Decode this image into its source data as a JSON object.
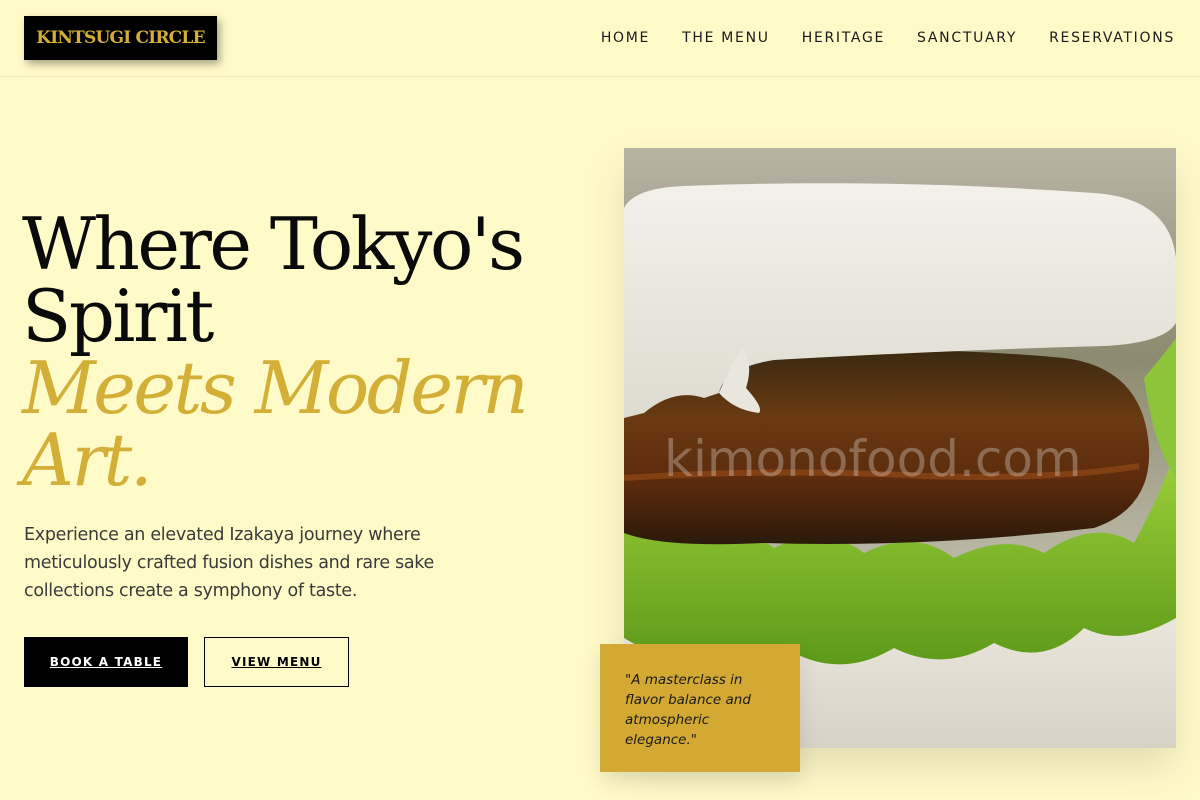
{
  "brand": {
    "logo_text": "KINTSUGI CIRCLE"
  },
  "nav": {
    "items": [
      "HOME",
      "THE MENU",
      "HERITAGE",
      "SANCTUARY",
      "RESERVATIONS"
    ]
  },
  "hero": {
    "headline_line1": "Where Tokyo's",
    "headline_line2": "Spirit",
    "headline_accent1": "Meets Modern",
    "headline_accent2": "Art.",
    "description": "Experience an elevated Izakaya journey where meticulously crafted fusion dishes and rare sake collections create a symphony of taste.",
    "primary_cta": "BOOK A TABLE",
    "secondary_cta": "VIEW MENU",
    "image_watermark": "kimonofood.com",
    "quote": "\"A masterclass in flavor balance and atmospheric elegance.\""
  },
  "colors": {
    "background": "#fffbc9",
    "accent_gold": "#d4af37",
    "quote_card": "#d4a933",
    "dark": "#000000"
  }
}
